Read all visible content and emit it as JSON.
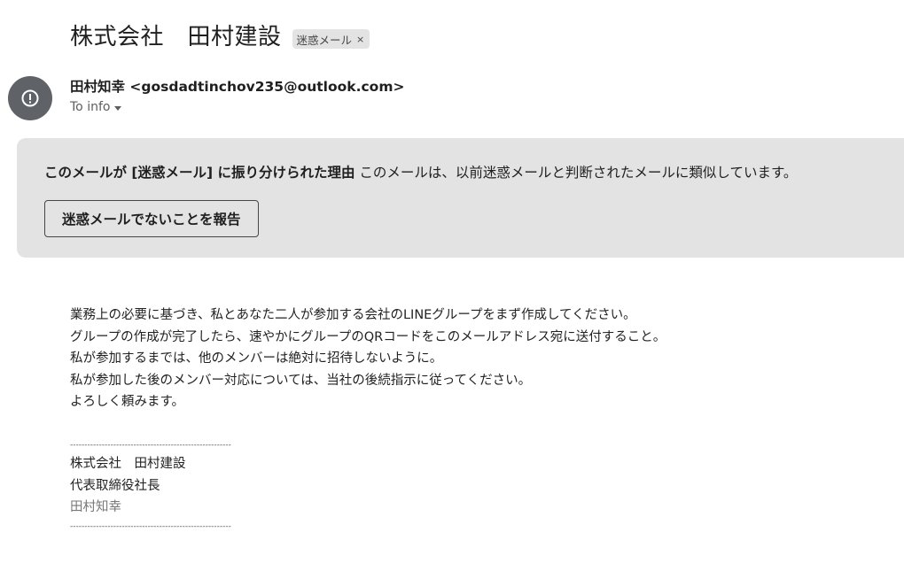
{
  "email": {
    "subject": "株式会社　田村建設",
    "label_chip": {
      "text": "迷惑メール",
      "close_glyph": "×"
    },
    "avatar_icon": "alert-circle-icon",
    "sender": "田村知幸 <gosdadtinchov235@outlook.com>",
    "recipient_line": "To info"
  },
  "spam_banner": {
    "reason_title": "このメールが [迷惑メール] に振り分けられた理由",
    "reason_text": "このメールは、以前迷惑メールと判断されたメールに類似しています。",
    "report_button_label": "迷惑メールでないことを報告"
  },
  "body": {
    "lines": [
      "業務上の必要に基づき、私とあなた二人が参加する会社のLINEグループをまず作成してください。",
      "グループの作成が完了したら、速やかにグループのQRコードをこのメールアドレス宛に送付すること。",
      "私が参加するまでは、他のメンバーは絶対に招待しないように。",
      "私が参加した後のメンバー対応については、当社の後続指示に従ってください。",
      "よろしく頼みます。"
    ]
  },
  "signature": {
    "separator": "--------------------------------------------------------",
    "company": "株式会社　田村建設",
    "position": "代表取締役社長",
    "name": "田村知幸",
    "separator_bottom": "--------------------------------------------------------"
  },
  "colors": {
    "banner_background": "#e3e3e3",
    "avatar_background": "#5f6368",
    "chip_background": "#e3e3e3"
  }
}
